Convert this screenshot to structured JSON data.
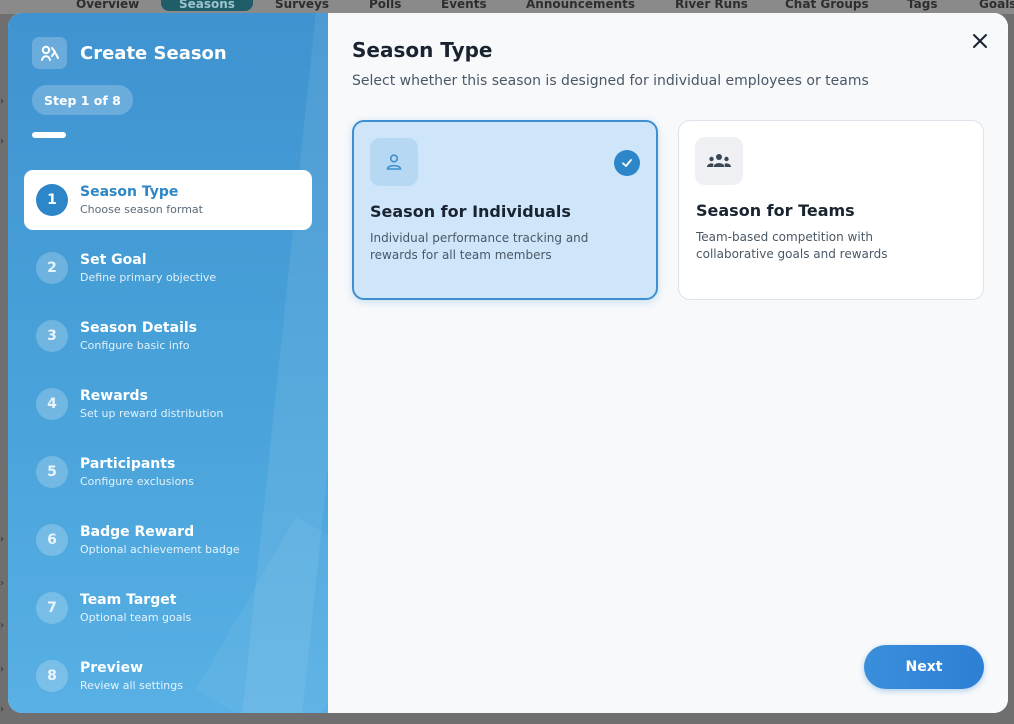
{
  "background": {
    "nav": [
      "Overview",
      "Seasons",
      "Surveys",
      "Polls",
      "Events",
      "Announcements",
      "River Runs",
      "Chat Groups",
      "Tags",
      "Goals"
    ],
    "active_nav": "Seasons"
  },
  "sidebar": {
    "title": "Create Season",
    "step_indicator": "Step 1 of 8",
    "progress_fraction": 0.125,
    "steps": [
      {
        "num": "1",
        "title": "Season Type",
        "subtitle": "Choose season format"
      },
      {
        "num": "2",
        "title": "Set Goal",
        "subtitle": "Define primary objective"
      },
      {
        "num": "3",
        "title": "Season Details",
        "subtitle": "Configure basic info"
      },
      {
        "num": "4",
        "title": "Rewards",
        "subtitle": "Set up reward distribution"
      },
      {
        "num": "5",
        "title": "Participants",
        "subtitle": "Configure exclusions"
      },
      {
        "num": "6",
        "title": "Badge Reward",
        "subtitle": "Optional achievement badge"
      },
      {
        "num": "7",
        "title": "Team Target",
        "subtitle": "Optional team goals"
      },
      {
        "num": "8",
        "title": "Preview",
        "subtitle": "Review all settings"
      }
    ]
  },
  "content": {
    "title": "Season Type",
    "subtitle": "Select whether this season is designed for individual employees or teams",
    "options": {
      "individual": {
        "title": "Season for Individuals",
        "description": "Individual performance tracking and rewards for all team members",
        "icon": "person-icon",
        "selected": true
      },
      "teams": {
        "title": "Season for Teams",
        "description": "Team-based competition with collaborative goals and rewards",
        "icon": "group-icon",
        "selected": false
      }
    },
    "next_label": "Next"
  },
  "colors": {
    "accent": "#2d86c8",
    "sidebar_top": "#3f93d0",
    "selected_card_bg": "#cfe6fa"
  }
}
